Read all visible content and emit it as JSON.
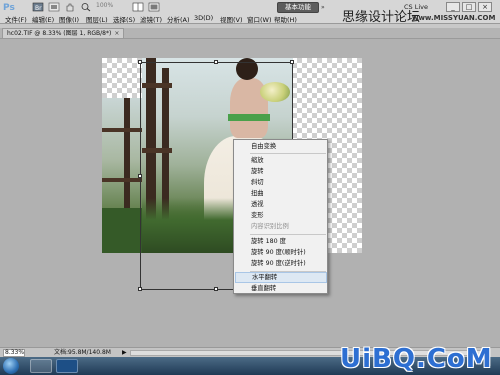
{
  "app": {
    "logo": "Ps"
  },
  "quick_tools": [
    {
      "name": "bridge-icon"
    },
    {
      "name": "mini-bridge-icon"
    },
    {
      "name": "zoom-level-menu",
      "label": "100%"
    },
    {
      "name": "arrange-docs-icon"
    },
    {
      "name": "screen-mode-icon"
    }
  ],
  "menu": [
    "文件(F)",
    "编辑(E)",
    "图像(I)",
    "图层(L)",
    "选择(S)",
    "滤镜(T)",
    "分析(A)",
    "3D(D)",
    "视图(V)",
    "窗口(W)",
    "帮助(H)"
  ],
  "workspace_button": "基本功能",
  "site_overlay": {
    "name": "思缘设计论坛",
    "url": "www.MISSYUAN.COM"
  },
  "cslive": "CS Live",
  "window_controls": [
    "_",
    "□",
    "×"
  ],
  "doc_tab": {
    "title": "hc02.TIF @ 8.33% (图层 1, RGB/8*)",
    "close": "×"
  },
  "context_menu": {
    "items": [
      {
        "label": "自由变换",
        "disabled": false
      },
      {
        "sep": true
      },
      {
        "label": "缩放",
        "disabled": false
      },
      {
        "label": "旋转",
        "disabled": false
      },
      {
        "label": "斜切",
        "disabled": false
      },
      {
        "label": "扭曲",
        "disabled": false
      },
      {
        "label": "透视",
        "disabled": false
      },
      {
        "label": "变形",
        "disabled": false
      },
      {
        "label": "内容识别比例",
        "disabled": true
      },
      {
        "sep": true
      },
      {
        "label": "旋转 180 度",
        "disabled": false
      },
      {
        "label": "旋转 90 度(顺时针)",
        "disabled": false
      },
      {
        "label": "旋转 90 度(逆时针)",
        "disabled": false
      },
      {
        "sep": true
      },
      {
        "label": "水平翻转",
        "disabled": false,
        "highlighted": true
      },
      {
        "label": "垂直翻转",
        "disabled": false
      }
    ]
  },
  "status": {
    "zoom": "8.33%",
    "doc_info": "文档:95.8M/140.8M",
    "arrow": "▶"
  },
  "brand_watermark": "UiBQ.CoM"
}
